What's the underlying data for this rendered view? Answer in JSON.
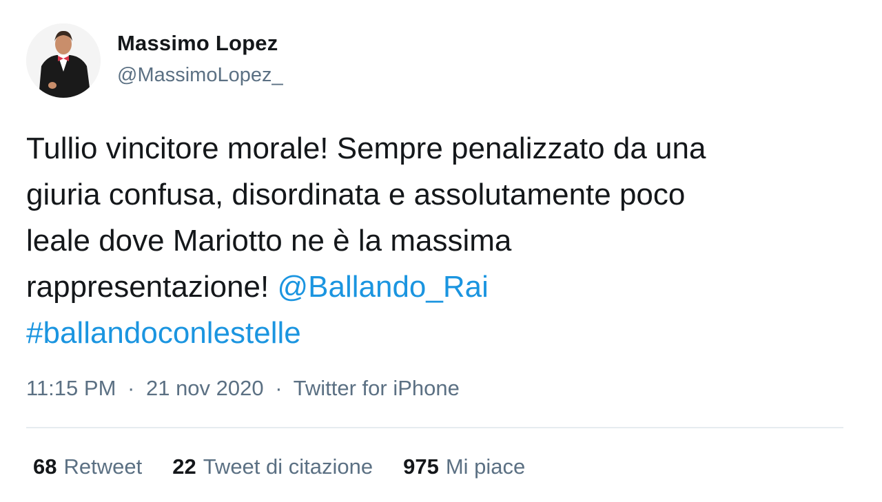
{
  "author": {
    "display_name": "Massimo Lopez",
    "handle": "@MassimoLopez_",
    "avatar_icon": "profile-photo-man-in-tuxedo"
  },
  "tweet": {
    "lines": [
      [
        {
          "text": "Tullio vincitore morale! Sempre penalizzato da una",
          "type": "text"
        }
      ],
      [
        {
          "text": "giuria confusa, disordinata e assolutamente poco",
          "type": "text"
        }
      ],
      [
        {
          "text": "leale dove Mariotto ne è la massima",
          "type": "text"
        }
      ],
      [
        {
          "text": "rappresentazione! ",
          "type": "text"
        },
        {
          "text": "@Ballando_Rai",
          "type": "mention"
        }
      ],
      [
        {
          "text": "#ballandoconlestelle",
          "type": "hashtag"
        }
      ]
    ]
  },
  "meta": {
    "time": "11:15 PM",
    "separator": "·",
    "date": "21 nov 2020",
    "source": "Twitter for iPhone"
  },
  "stats": [
    {
      "count": "68",
      "label": "Retweet"
    },
    {
      "count": "22",
      "label": "Tweet di citazione"
    },
    {
      "count": "975",
      "label": "Mi piace"
    }
  ],
  "colors": {
    "link": "#1b95e0",
    "secondary_text": "#5b7083",
    "primary_text": "#14171a",
    "divider": "#e6ecf0"
  }
}
